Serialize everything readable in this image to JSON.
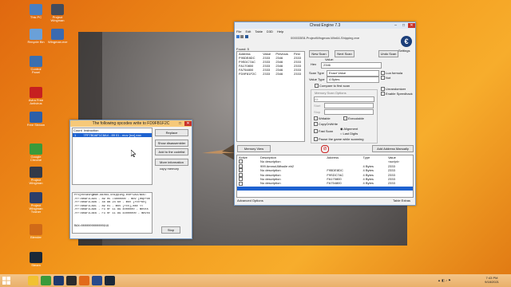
{
  "desktop": {
    "icons": [
      {
        "label": "This PC",
        "color": "#4a7fc1"
      },
      {
        "label": "Recycle Bin",
        "color": "#6aa0d8"
      },
      {
        "label": "Control Panel",
        "color": "#3a6fb0"
      },
      {
        "label": "Avira Free Antivirus",
        "color": "#c62020"
      },
      {
        "label": "Free Stream",
        "color": "#2d5fa8"
      },
      {
        "label": "Google Chrome",
        "color": "#3a9a3a"
      },
      {
        "label": "Project Wingman",
        "color": "#333a48"
      },
      {
        "label": "Project Wingman Trainer",
        "color": "#2c3e6a"
      },
      {
        "label": "Blender",
        "color": "#d06a18"
      },
      {
        "label": "Steam",
        "color": "#1b2838"
      }
    ],
    "right_icons": [
      {
        "label": "Project Wingman",
        "color": "#444c5c"
      },
      {
        "label": "Wingman.exe",
        "color": "#3a6ab0"
      }
    ]
  },
  "cheat_engine": {
    "title": "Cheat Engine 7.3",
    "menu": [
      "File",
      "Edit",
      "Table",
      "D3D",
      "Help"
    ],
    "process": "000033E8-ProjectWingman-Win64-Shipping.exe",
    "found_label": "Found: 5",
    "columns": [
      "Address",
      "Value",
      "Previous",
      "First"
    ],
    "results": [
      [
        "F95DE8DC",
        "2333",
        "2346",
        "2333"
      ],
      [
        "F9SDC7AC",
        "2333",
        "2346",
        "2333"
      ],
      [
        "FA170800",
        "2333",
        "2346",
        "2333"
      ],
      [
        "FA754800",
        "2333",
        "2346",
        "2333"
      ],
      [
        "FD9F81F2C",
        "2333",
        "2346",
        "2333"
      ]
    ],
    "new_scan": "New Scan",
    "next_scan": "Next Scan",
    "undo_scan": "Undo Scan",
    "settings": "Settings",
    "value_label": "Value:",
    "hex_label": "Hex",
    "value_input": "2346",
    "scan_type_label": "Scan Type",
    "scan_type_value": "Exact Value",
    "value_type_label": "Value Type",
    "value_type_value": "4 Bytes",
    "compare_first": "Compare to first scan",
    "lua_formula": "Lua formula",
    "not_label": "Not",
    "unrandomizer": "Unrandomizer",
    "speedhack": "Enable Speedhack",
    "memory_options": "Memory Scan Options",
    "all_label": "All",
    "start_label": "Start",
    "stop_label": "Stop",
    "writable": "Writable",
    "executable": "Executable",
    "copy_on_write": "CopyOnWrite",
    "fast_scan": "Fast Scan",
    "alignment": "Alignment",
    "last_digits": "Last Digits",
    "pause_game": "Pause the game while scanning",
    "memory_view": "Memory View",
    "add_address": "Add Address Manually",
    "table_columns": [
      "Active",
      "Description",
      "Address",
      "Type",
      "Value"
    ],
    "table_rows": [
      [
        "",
        "No description",
        "",
        "",
        "<script>"
      ],
      [
        "",
        "999 AmmoUMissile eb2",
        "",
        "4 Bytes",
        "2333"
      ],
      [
        "",
        "No description",
        "F95DE8DC",
        "4 Bytes",
        "2333"
      ],
      [
        "",
        "No description",
        "F9SDC7AC",
        "4 Bytes",
        "2333"
      ],
      [
        "",
        "No description",
        "FA170800",
        "4 Bytes",
        "2333"
      ],
      [
        "",
        "No description",
        "FA754800",
        "4 Bytes",
        "2333"
      ]
    ],
    "advanced_options": "Advanced Options",
    "table_extras": "Table Extras"
  },
  "opcodes_dialog": {
    "title": "The following opcodes write to FD9FB1F2C",
    "columns": [
      "Count",
      "Instruction"
    ],
    "row": [
      "1",
      "7FF7B0AF1C8A4 - 89 01 - mov [rcx],eax"
    ],
    "buttons": [
      "Replace",
      "Show disassembler",
      "Add to the codelist",
      "More information",
      "copy memory"
    ],
    "detail_lines": [
      "ProjectWingman-Win64-Shipping.exe+2A47BD6:",
      "7FF7B0AF1C8D4 - 89 05 74000000 - mov [ebp+000000",
      "7FF7B0AF1C8D6 - 48 8B 24 60 - mov [rcx+60]",
      "7FF7B0AF1C8DC - 89 01 - mov [rcx],eax <<",
      "7FF7B0AF1C8DE - F3 0F 11 89 4000000 - movss [rbx+",
      "7FF7B0AF1C8E6 - F3 0F 11 89 44000000 - movss [rbx+"
    ],
    "rax_line": "RAX=0000000000000919",
    "stop": "Stop"
  },
  "taskbar": {
    "apps": [
      {
        "name": "file-explorer",
        "color": "#f1c232"
      },
      {
        "name": "chrome",
        "color": "#3a9a3a"
      },
      {
        "name": "cheat-engine-a",
        "color": "#1e3a6e"
      },
      {
        "name": "cheat-engine-b",
        "color": "#2c2c2c"
      },
      {
        "name": "firefox",
        "color": "#e26a1a"
      },
      {
        "name": "cheat-engine-c",
        "color": "#274a8c"
      },
      {
        "name": "steam",
        "color": "#1b2838"
      }
    ],
    "time": "7:43 PM",
    "date": "9/18/2021"
  }
}
